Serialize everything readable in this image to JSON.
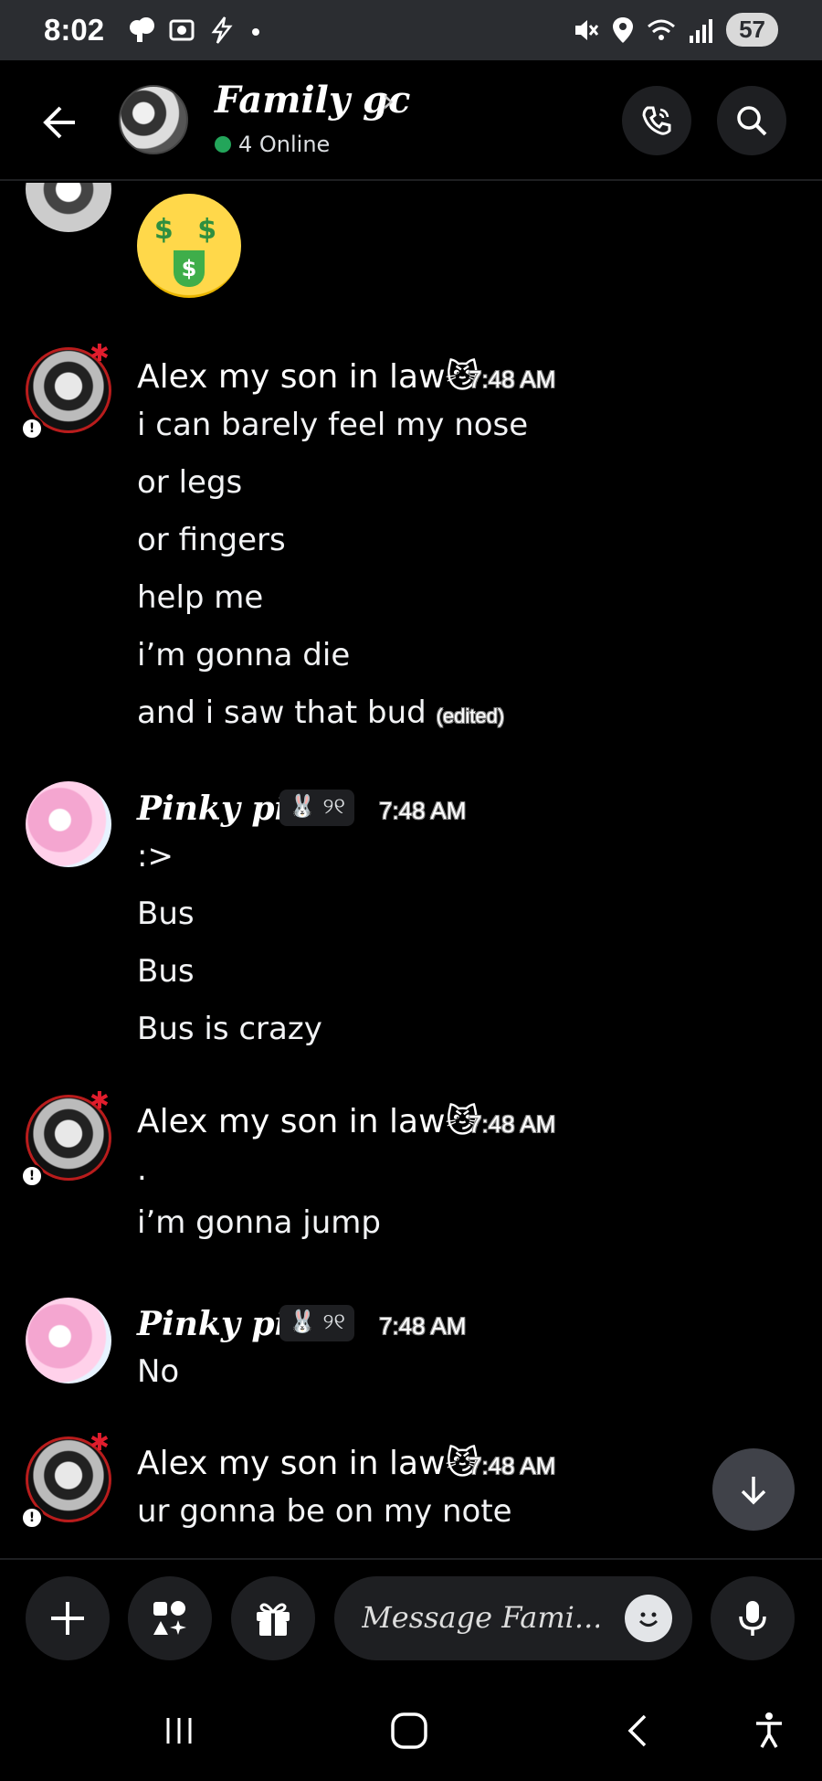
{
  "status_bar": {
    "time": "8:02",
    "battery": "57",
    "left_icons": [
      "cloud-icon",
      "screen-record-icon",
      "lightning-icon",
      "dot-icon"
    ],
    "right_icons": [
      "mute-icon",
      "location-icon",
      "wifi-icon",
      "signal-icon"
    ]
  },
  "header": {
    "title": "Family gc",
    "online": "4 Online",
    "online_color": "#23a55a"
  },
  "messages": [
    {
      "author": "Alex my son in law",
      "author_emoji": "😼",
      "time": "7:48 AM",
      "lines": [
        "i can barely feel my nose",
        "or legs",
        "or fingers",
        "help me",
        "i’m gonna die",
        "and i saw that bud"
      ],
      "edited": "(edited)"
    },
    {
      "author": "Pinky pie",
      "tag": "🐰 ୨୧",
      "time": "7:48 AM",
      "lines": [
        ":>",
        "Bus",
        "Bus",
        "Bus is crazy"
      ]
    },
    {
      "author": "Alex my son in law",
      "author_emoji": "😼",
      "time": "7:48 AM",
      "lines": [
        ".",
        "i’m gonna jump"
      ]
    },
    {
      "author": "Pinky pie",
      "tag": "🐰 ୨୧",
      "time": "7:48 AM",
      "lines": [
        "No"
      ]
    },
    {
      "author": "Alex my son in law",
      "author_emoji": "😼",
      "time": "7:48 AM",
      "lines": [
        "ur gonna be on my note"
      ]
    }
  ],
  "top_emoji": {
    "eyes": "$ $",
    "tongue": "$"
  },
  "composer": {
    "placeholder": "Message Fami..."
  },
  "colors": {
    "background": "#000000",
    "status_bar": "#2b2d31",
    "button_bg": "#1e1f22",
    "online_green": "#23a55a",
    "avatar_ring": "#b91c1c"
  }
}
